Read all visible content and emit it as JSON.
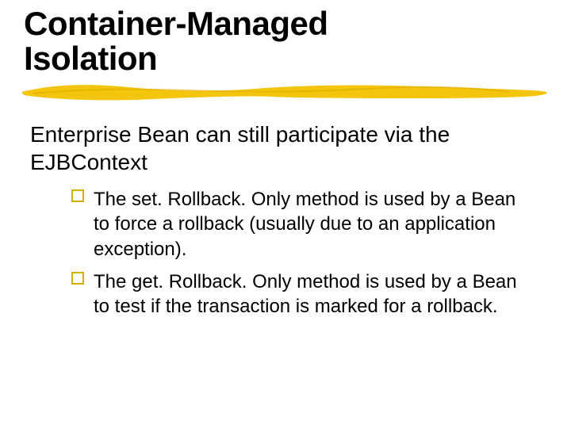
{
  "title_line1": "Container-Managed",
  "title_line2": "Isolation",
  "body": "Enterprise Bean can still participate via the EJBContext",
  "bullets": [
    "The set. Rollback. Only method is used by a Bean to force a rollback (usually due to an application exception).",
    "The get. Rollback. Only method is used by a Bean to test if the transaction is marked for a rollback."
  ],
  "colors": {
    "underline": "#f2c200",
    "bullet_border": "#d1b000"
  }
}
